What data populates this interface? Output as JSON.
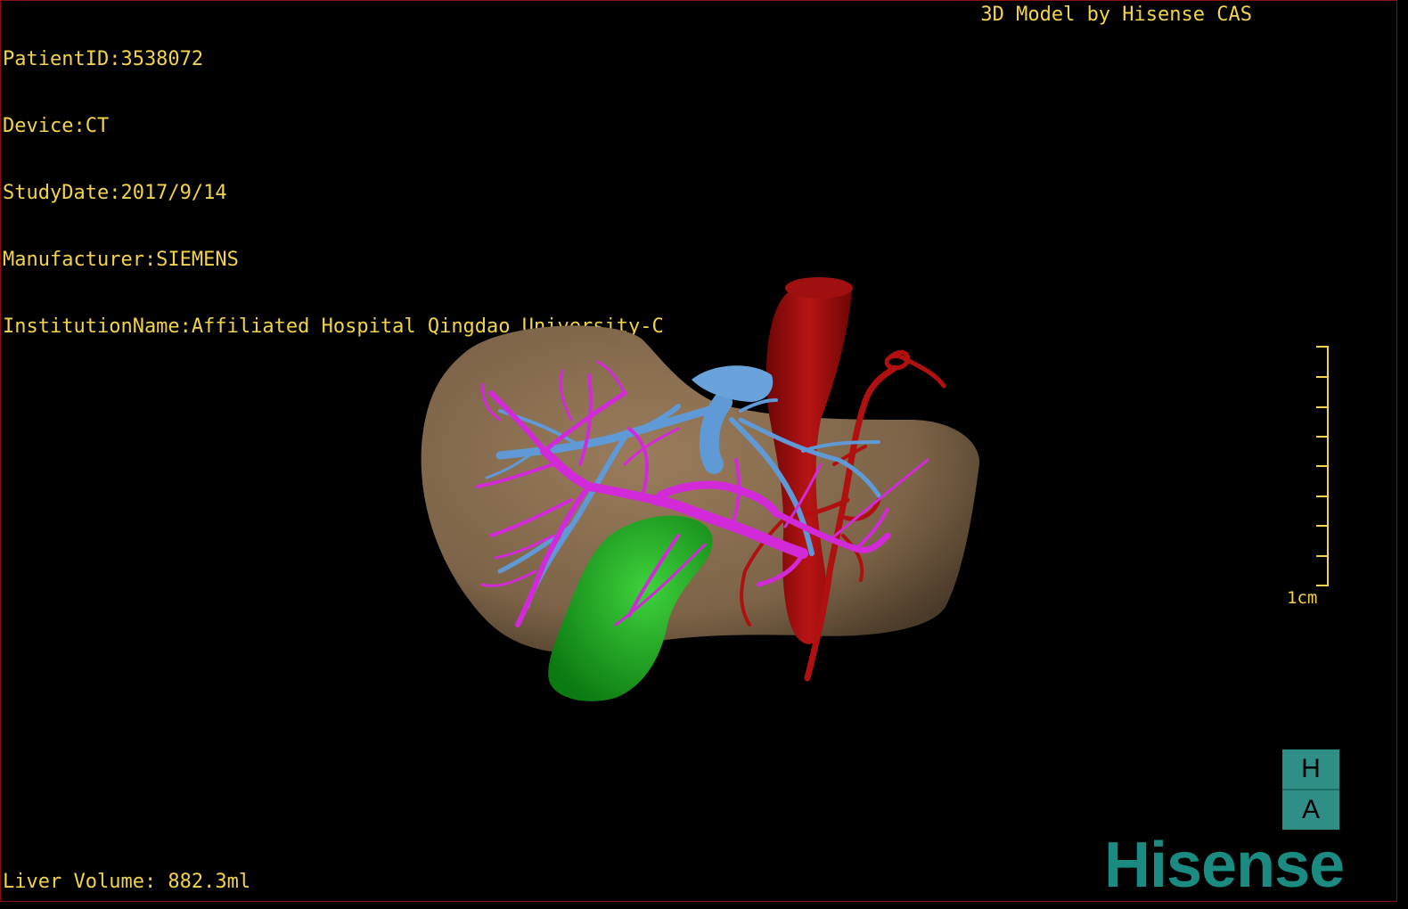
{
  "header": {
    "patient_id": "PatientID:3538072",
    "device": "Device:CT",
    "study_date": "StudyDate:2017/9/14",
    "manufacturer": "Manufacturer:SIEMENS",
    "institution": "InstitutionName:Affiliated Hospital Qingdao University-C",
    "watermark": "3D Model by Hisense CAS"
  },
  "footer": {
    "liver_volume": "Liver Volume: 882.3ml"
  },
  "scale_bar": {
    "label": "1cm"
  },
  "orientation": {
    "top": "H",
    "bottom": "A"
  },
  "brand": {
    "name": "Hisense"
  },
  "colors": {
    "text": "#f3d34b",
    "liver": "#8a6d4f",
    "portal_vein": "#d22ad8",
    "hepatic_vein": "#5f9ad6",
    "artery": "#b01010",
    "gallbladder": "#18a51d",
    "brand": "#1b8b82"
  }
}
